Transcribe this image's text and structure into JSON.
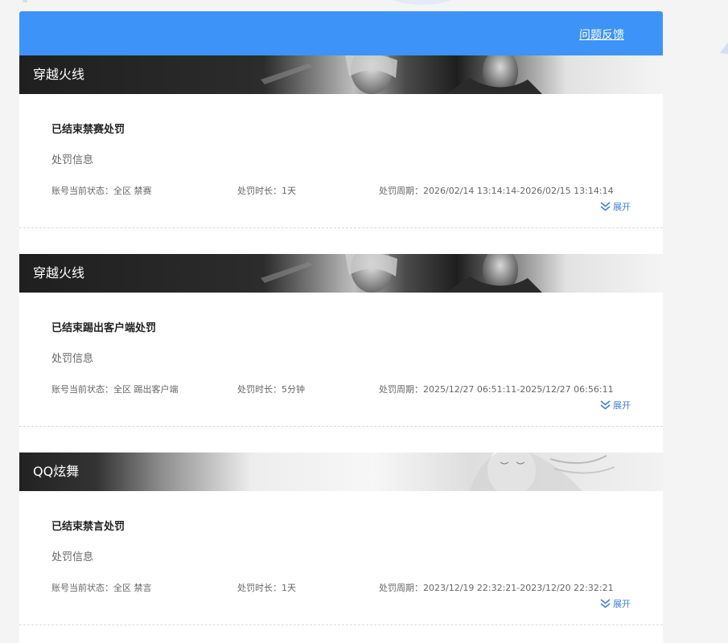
{
  "header": {
    "feedback_label": "问题反馈"
  },
  "records": [
    {
      "game": "穿越火线",
      "banner_style": "cf",
      "title": "已结束禁赛处罚",
      "info_label": "处罚信息",
      "status_label": "账号当前状态：",
      "status_value": "全区 禁赛",
      "duration_label": "处罚时长：",
      "duration_value": "1天",
      "period_label": "处罚周期：",
      "period_value": "2026/02/14 13:14:14-2026/02/15 13:14:14",
      "expand_label": "展开"
    },
    {
      "game": "穿越火线",
      "banner_style": "cf",
      "title": "已结束踢出客户端处罚",
      "info_label": "处罚信息",
      "status_label": "账号当前状态：",
      "status_value": "全区 踢出客户端",
      "duration_label": "处罚时长：",
      "duration_value": "5分钟",
      "period_label": "处罚周期：",
      "period_value": "2025/12/27 06:51:11-2025/12/27 06:56:11",
      "expand_label": "展开"
    },
    {
      "game": "QQ炫舞",
      "banner_style": "dance",
      "title": "已结束禁言处罚",
      "info_label": "处罚信息",
      "status_label": "账号当前状态：",
      "status_value": "全区 禁言",
      "duration_label": "处罚时长：",
      "duration_value": "1天",
      "period_label": "处罚周期：",
      "period_value": "2023/12/19 22:32:21-2023/12/20 22:32:21",
      "expand_label": "展开"
    }
  ],
  "colors": {
    "accent": "#3d93f8",
    "link": "#3d7fd6"
  },
  "icons": {
    "expand": "double-chevron-down-icon"
  }
}
